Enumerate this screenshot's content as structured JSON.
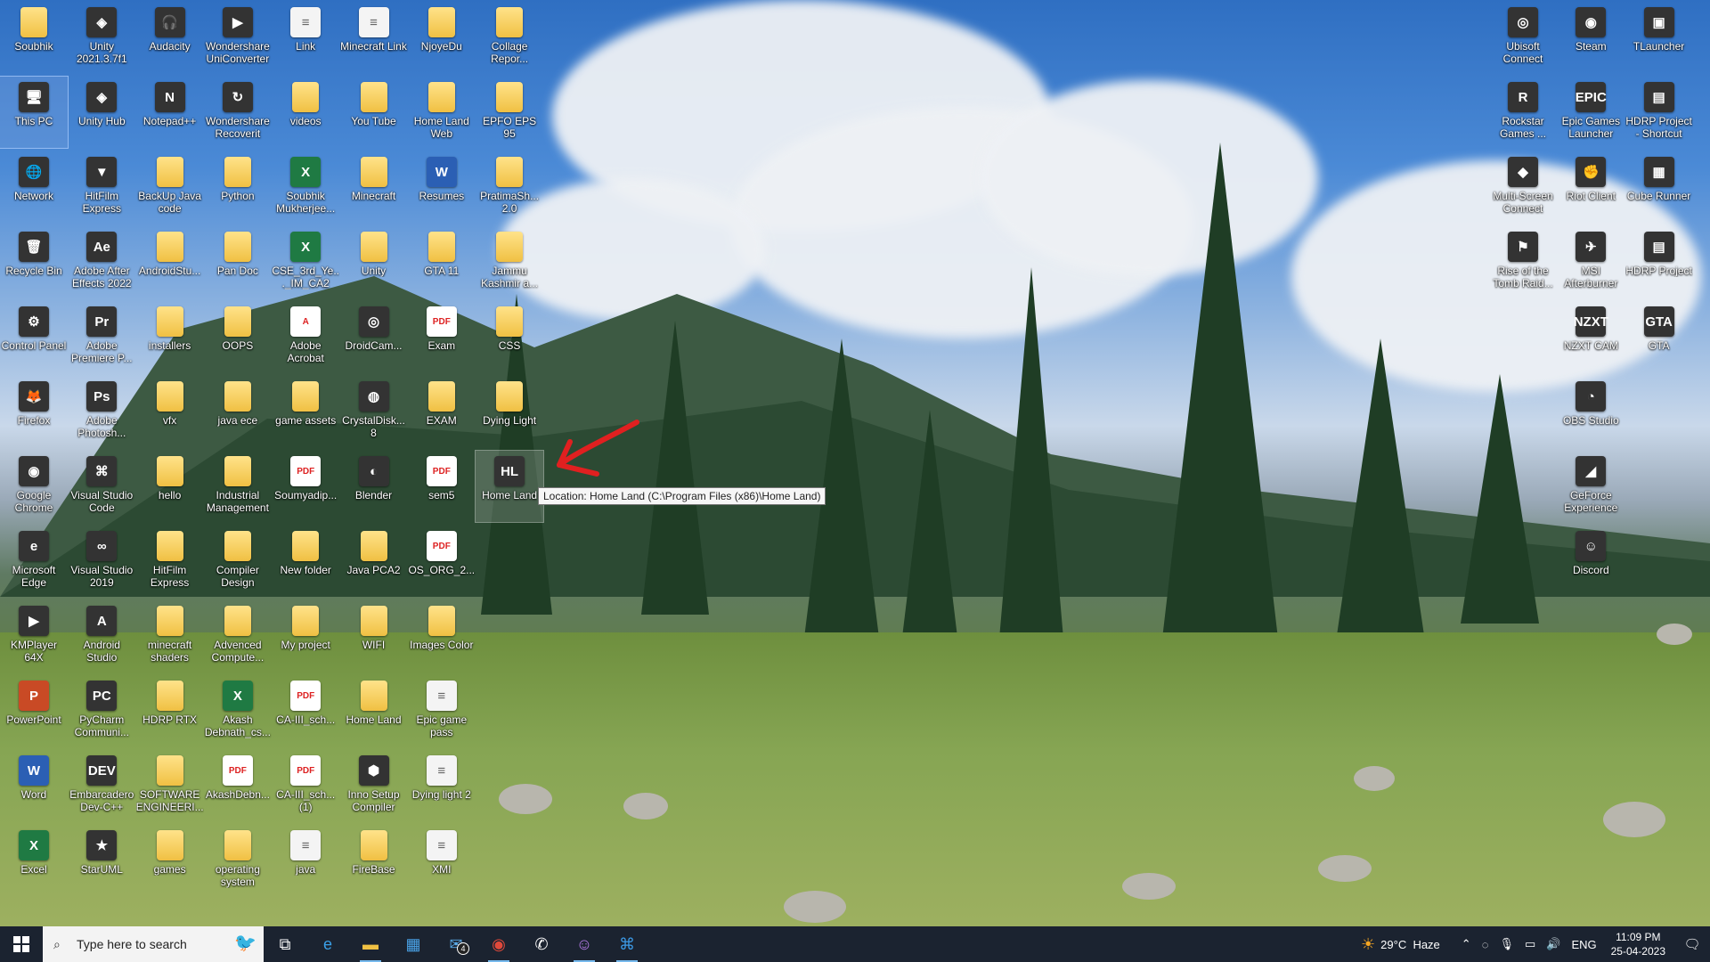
{
  "desktop": {
    "columns": [
      [
        {
          "label": "Soubhik",
          "kind": "folder"
        },
        {
          "label": "This PC",
          "kind": "app",
          "glyph": "🖥",
          "selected": true
        },
        {
          "label": "Network",
          "kind": "app",
          "glyph": "🌐"
        },
        {
          "label": "Recycle Bin",
          "kind": "app",
          "glyph": "🗑"
        },
        {
          "label": "Control Panel",
          "kind": "app",
          "glyph": "⚙"
        },
        {
          "label": "Firefox",
          "kind": "app",
          "glyph": "🦊"
        },
        {
          "label": "Google Chrome",
          "kind": "app",
          "glyph": "◉"
        },
        {
          "label": "Microsoft Edge",
          "kind": "app",
          "glyph": "e"
        },
        {
          "label": "KMPlayer 64X",
          "kind": "app",
          "glyph": "▶"
        },
        {
          "label": "PowerPoint",
          "kind": "ppt",
          "glyph": "P"
        },
        {
          "label": "Word",
          "kind": "word",
          "glyph": "W"
        },
        {
          "label": "Excel",
          "kind": "excel",
          "glyph": "X"
        }
      ],
      [
        {
          "label": "Unity 2021.3.7f1",
          "kind": "app",
          "glyph": "◈"
        },
        {
          "label": "Unity Hub",
          "kind": "app",
          "glyph": "◈"
        },
        {
          "label": "HitFilm Express",
          "kind": "app",
          "glyph": "▼"
        },
        {
          "label": "Adobe After Effects 2022",
          "kind": "app",
          "glyph": "Ae"
        },
        {
          "label": "Adobe Premiere P...",
          "kind": "app",
          "glyph": "Pr"
        },
        {
          "label": "Adobe Photosh...",
          "kind": "app",
          "glyph": "Ps"
        },
        {
          "label": "Visual Studio Code",
          "kind": "app",
          "glyph": "⌘"
        },
        {
          "label": "Visual Studio 2019",
          "kind": "app",
          "glyph": "∞"
        },
        {
          "label": "Android Studio",
          "kind": "app",
          "glyph": "A"
        },
        {
          "label": "PyCharm Communi...",
          "kind": "app",
          "glyph": "PC"
        },
        {
          "label": "Embarcadero Dev-C++",
          "kind": "app",
          "glyph": "DEV"
        },
        {
          "label": "StarUML",
          "kind": "app",
          "glyph": "★"
        }
      ],
      [
        {
          "label": "Audacity",
          "kind": "app",
          "glyph": "🎧"
        },
        {
          "label": "Notepad++",
          "kind": "app",
          "glyph": "N"
        },
        {
          "label": "BackUp Java code",
          "kind": "folder"
        },
        {
          "label": "AndroidStu...",
          "kind": "folder"
        },
        {
          "label": "installers",
          "kind": "folder"
        },
        {
          "label": "vfx",
          "kind": "folder"
        },
        {
          "label": "hello",
          "kind": "folder"
        },
        {
          "label": "HitFilm Express",
          "kind": "folder"
        },
        {
          "label": "minecraft shaders",
          "kind": "folder"
        },
        {
          "label": "HDRP RTX",
          "kind": "folder"
        },
        {
          "label": "SOFTWARE ENGINEERI...",
          "kind": "folder"
        },
        {
          "label": "games",
          "kind": "folder"
        }
      ],
      [
        {
          "label": "Wondershare UniConverter",
          "kind": "app",
          "glyph": "▶"
        },
        {
          "label": "Wondershare Recoverit",
          "kind": "app",
          "glyph": "↻"
        },
        {
          "label": "Python",
          "kind": "folder"
        },
        {
          "label": "Pan Doc",
          "kind": "folder"
        },
        {
          "label": "OOPS",
          "kind": "folder"
        },
        {
          "label": "java ece",
          "kind": "folder"
        },
        {
          "label": "Industrial Management",
          "kind": "folder"
        },
        {
          "label": "Compiler Design",
          "kind": "folder"
        },
        {
          "label": "Advenced Compute...",
          "kind": "folder"
        },
        {
          "label": "Akash Debnath_cs...",
          "kind": "excel",
          "glyph": "X"
        },
        {
          "label": "AkashDebn...",
          "kind": "pdf",
          "glyph": "PDF"
        },
        {
          "label": "operating system",
          "kind": "folder"
        }
      ],
      [
        {
          "label": "Link",
          "kind": "doc",
          "glyph": "≡"
        },
        {
          "label": "videos",
          "kind": "folder"
        },
        {
          "label": "Soubhik Mukherjee...",
          "kind": "excel",
          "glyph": "X"
        },
        {
          "label": "CSE_3rd_Ye..._IM_CA2",
          "kind": "excel",
          "glyph": "X"
        },
        {
          "label": "Adobe Acrobat",
          "kind": "pdf",
          "glyph": "A"
        },
        {
          "label": "game assets",
          "kind": "folder"
        },
        {
          "label": "Soumyadip...",
          "kind": "pdf",
          "glyph": "PDF"
        },
        {
          "label": "New folder",
          "kind": "folder"
        },
        {
          "label": "My project",
          "kind": "folder"
        },
        {
          "label": "CA-III_sch...",
          "kind": "pdf",
          "glyph": "PDF"
        },
        {
          "label": "CA-III_sch... (1)",
          "kind": "pdf",
          "glyph": "PDF"
        },
        {
          "label": "java",
          "kind": "doc",
          "glyph": "≡"
        }
      ],
      [
        {
          "label": "Minecraft Link",
          "kind": "doc",
          "glyph": "≡"
        },
        {
          "label": "You Tube",
          "kind": "folder"
        },
        {
          "label": "Minecraft",
          "kind": "folder"
        },
        {
          "label": "Unity",
          "kind": "folder"
        },
        {
          "label": "DroidCam...",
          "kind": "app",
          "glyph": "◎"
        },
        {
          "label": "CrystalDisk... 8",
          "kind": "app",
          "glyph": "◍"
        },
        {
          "label": "Blender",
          "kind": "app",
          "glyph": "◐"
        },
        {
          "label": "Java PCA2",
          "kind": "folder"
        },
        {
          "label": "WIFI",
          "kind": "folder"
        },
        {
          "label": "Home Land",
          "kind": "folder"
        },
        {
          "label": "Inno Setup Compiler",
          "kind": "app",
          "glyph": "⬢"
        },
        {
          "label": "FireBase",
          "kind": "folder"
        }
      ],
      [
        {
          "label": "NjoyeDu",
          "kind": "folder"
        },
        {
          "label": "Home Land Web",
          "kind": "folder"
        },
        {
          "label": "Resumes",
          "kind": "word",
          "glyph": "W"
        },
        {
          "label": "GTA 11",
          "kind": "folder"
        },
        {
          "label": "Exam",
          "kind": "pdf",
          "glyph": "PDF"
        },
        {
          "label": "EXAM",
          "kind": "folder"
        },
        {
          "label": "sem5",
          "kind": "pdf",
          "glyph": "PDF"
        },
        {
          "label": "OS_ORG_2...",
          "kind": "pdf",
          "glyph": "PDF"
        },
        {
          "label": "Images Color",
          "kind": "folder"
        },
        {
          "label": "Epic game pass",
          "kind": "doc",
          "glyph": "≡"
        },
        {
          "label": "Dying light 2",
          "kind": "doc",
          "glyph": "≡"
        },
        {
          "label": "XMI",
          "kind": "doc",
          "glyph": "≡"
        }
      ],
      [
        {
          "label": "Collage Repor...",
          "kind": "folder"
        },
        {
          "label": "EPFO EPS 95",
          "kind": "folder"
        },
        {
          "label": "PratimaSh... 2.0",
          "kind": "folder"
        },
        {
          "label": "Jammu Kashmir a...",
          "kind": "folder"
        },
        {
          "label": "CSS",
          "kind": "folder"
        },
        {
          "label": "Dying Light",
          "kind": "folder"
        },
        {
          "label": "Home Land",
          "kind": "app",
          "glyph": "HL",
          "hover": true
        }
      ]
    ],
    "right_columns": [
      [
        {
          "label": "Ubisoft Connect",
          "kind": "app",
          "glyph": "◎"
        },
        {
          "label": "Rockstar Games ...",
          "kind": "app",
          "glyph": "R"
        },
        {
          "label": "Multi-Screen Connect",
          "kind": "app",
          "glyph": "◆"
        },
        {
          "label": "Rise of the Tomb Raid...",
          "kind": "app",
          "glyph": "⚑"
        }
      ],
      [
        {
          "label": "Steam",
          "kind": "app",
          "glyph": "◉"
        },
        {
          "label": "Epic Games Launcher",
          "kind": "app",
          "glyph": "EPIC"
        },
        {
          "label": "Riot Client",
          "kind": "app",
          "glyph": "✊"
        },
        {
          "label": "MSI Afterburner",
          "kind": "app",
          "glyph": "✈"
        },
        {
          "label": "NZXT CAM",
          "kind": "app",
          "glyph": "NZXT"
        },
        {
          "label": "OBS Studio",
          "kind": "app",
          "glyph": "◔"
        },
        {
          "label": "GeForce Experience",
          "kind": "app",
          "glyph": "◢"
        },
        {
          "label": "Discord",
          "kind": "app",
          "glyph": "☺"
        }
      ],
      [
        {
          "label": "TLauncher",
          "kind": "app",
          "glyph": "▣"
        },
        {
          "label": "HDRP Project - Shortcut",
          "kind": "app",
          "glyph": "▤"
        },
        {
          "label": "Cube Runner",
          "kind": "app",
          "glyph": "▦"
        },
        {
          "label": "HDRP Project",
          "kind": "app",
          "glyph": "▤"
        },
        {
          "label": "GTA",
          "kind": "app",
          "glyph": "GTA"
        }
      ]
    ],
    "tooltip": "Location: Home Land (C:\\Program Files (x86)\\Home Land)"
  },
  "taskbar": {
    "search_placeholder": "Type here to search",
    "mail_badge": "4",
    "weather_temp": "29°C",
    "weather_desc": "Haze",
    "language": "ENG",
    "time": "11:09 PM",
    "date": "25-04-2023"
  },
  "colors": {
    "taskbar_bg": "#1b2330",
    "active_indicator": "#76b9ed",
    "annotation_arrow": "#e02020"
  }
}
